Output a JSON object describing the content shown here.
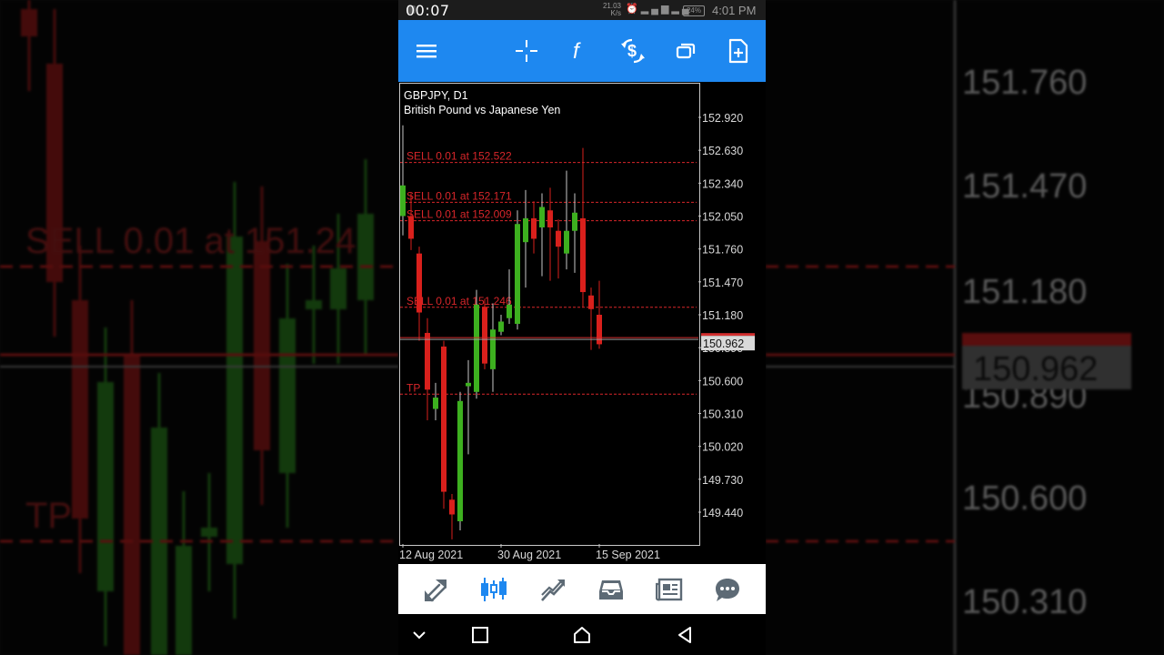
{
  "status_bar": {
    "recording_time": "00:07",
    "net_speed_value": "21.03",
    "net_speed_unit": "K/s",
    "battery": "24%",
    "clock": "4:01 PM"
  },
  "toolbar": {
    "menu_icon": "hamburger-menu-icon",
    "crosshair_icon": "crosshair-icon",
    "indicators_icon": "function-f-icon",
    "trade_icon": "dollar-exchange-icon",
    "windows_icon": "windows-icon",
    "new_order_icon": "add-document-icon",
    "color": "#1e88f0"
  },
  "chart": {
    "symbol": "GBPJPY, D1",
    "description": "British Pound vs Japanese Yen",
    "current_price": "150.962",
    "current_price_color": "#d32f2f",
    "bull_color": "#3db01f",
    "bear_color": "#d9201c",
    "order_line_color": "#d8262a"
  },
  "chart_data": {
    "type": "candlestick",
    "title": "GBPJPY, D1",
    "subtitle": "British Pound vs Japanese Yen",
    "y_ticks": [
      "152.920",
      "152.630",
      "152.340",
      "152.050",
      "151.760",
      "151.470",
      "151.180",
      "150.890",
      "150.600",
      "150.310",
      "150.020",
      "149.730",
      "149.440"
    ],
    "y_range": [
      149.2,
      153.2
    ],
    "x_ticks": [
      {
        "label": "12 Aug 2021",
        "index": 0
      },
      {
        "label": "30 Aug 2021",
        "index": 12
      },
      {
        "label": "15 Sep 2021",
        "index": 24
      }
    ],
    "candles": [
      {
        "o": 152.05,
        "h": 152.85,
        "l": 151.88,
        "c": 152.32
      },
      {
        "o": 152.05,
        "h": 152.25,
        "l": 151.75,
        "c": 151.85
      },
      {
        "o": 151.72,
        "h": 151.78,
        "l": 150.95,
        "c": 151.2
      },
      {
        "o": 151.02,
        "h": 151.15,
        "l": 150.25,
        "c": 150.52
      },
      {
        "o": 150.35,
        "h": 150.58,
        "l": 150.25,
        "c": 150.45
      },
      {
        "o": 150.9,
        "h": 150.95,
        "l": 149.47,
        "c": 149.62
      },
      {
        "o": 149.55,
        "h": 149.6,
        "l": 149.2,
        "c": 149.42
      },
      {
        "o": 149.36,
        "h": 150.5,
        "l": 149.28,
        "c": 150.42
      },
      {
        "o": 150.55,
        "h": 150.78,
        "l": 149.95,
        "c": 150.58
      },
      {
        "o": 150.5,
        "h": 151.4,
        "l": 150.44,
        "c": 151.27
      },
      {
        "o": 151.25,
        "h": 151.32,
        "l": 150.7,
        "c": 150.75
      },
      {
        "o": 150.7,
        "h": 151.28,
        "l": 150.5,
        "c": 151.05
      },
      {
        "o": 151.03,
        "h": 151.18,
        "l": 151.0,
        "c": 151.12
      },
      {
        "o": 151.15,
        "h": 151.58,
        "l": 151.1,
        "c": 151.27
      },
      {
        "o": 151.1,
        "h": 152.1,
        "l": 151.05,
        "c": 151.98
      },
      {
        "o": 151.82,
        "h": 152.28,
        "l": 151.42,
        "c": 152.03
      },
      {
        "o": 152.03,
        "h": 152.18,
        "l": 151.72,
        "c": 151.85
      },
      {
        "o": 151.95,
        "h": 152.25,
        "l": 151.52,
        "c": 152.13
      },
      {
        "o": 152.1,
        "h": 152.3,
        "l": 151.48,
        "c": 151.95
      },
      {
        "o": 151.92,
        "h": 152.02,
        "l": 151.5,
        "c": 151.78
      },
      {
        "o": 151.72,
        "h": 152.45,
        "l": 151.58,
        "c": 151.92
      },
      {
        "o": 151.92,
        "h": 152.25,
        "l": 151.55,
        "c": 152.08
      },
      {
        "o": 152.03,
        "h": 152.65,
        "l": 151.25,
        "c": 151.38
      },
      {
        "o": 151.35,
        "h": 151.42,
        "l": 150.87,
        "c": 151.23
      },
      {
        "o": 151.18,
        "h": 151.48,
        "l": 150.88,
        "c": 150.92
      }
    ],
    "order_lines": [
      {
        "label": "SELL 0.01 at 152.522",
        "price": 152.522
      },
      {
        "label": "SELL 0.01 at 152.171",
        "price": 152.171
      },
      {
        "label": "SELL 0.01 at 152.009",
        "price": 152.009
      },
      {
        "label": "SELL 0.01 at 151.246",
        "price": 151.246
      },
      {
        "label": "TP",
        "price": 150.48
      }
    ],
    "current_price": 150.962,
    "grid": false
  },
  "bottom_nav": [
    {
      "name": "quotes",
      "icon": "arrows-updown-icon",
      "active": false
    },
    {
      "name": "chart",
      "icon": "candles-icon",
      "active": true
    },
    {
      "name": "trade",
      "icon": "trend-chart-icon",
      "active": false
    },
    {
      "name": "history",
      "icon": "inbox-icon",
      "active": false
    },
    {
      "name": "news",
      "icon": "news-icon",
      "active": false
    },
    {
      "name": "messages",
      "icon": "chat-bubble-icon",
      "active": false
    }
  ],
  "system_nav": [
    "chevron-down-icon",
    "square-recent-icon",
    "home-icon",
    "back-icon"
  ],
  "background_blur": {
    "price_labels": [
      "151.760",
      "151.470",
      "151.180",
      "150.890",
      "150.600",
      "150.310"
    ],
    "current_price": "150.962",
    "sell_label": "SELL 0.01 at 151.24",
    "tp_label": "TP"
  }
}
